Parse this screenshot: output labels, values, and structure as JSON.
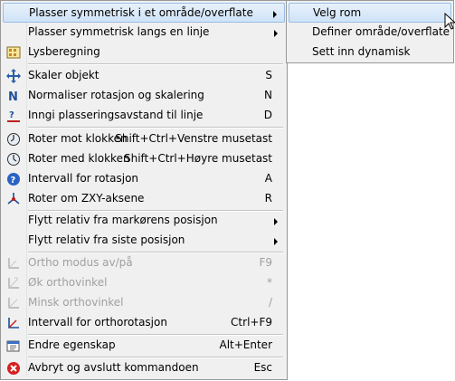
{
  "menu": {
    "items": [
      {
        "label": "Plasser symmetrisk i et område/overflate",
        "shortcut": "",
        "submenu": true,
        "icon": "none",
        "highlight": true
      },
      {
        "label": "Plasser symmetrisk langs en linje",
        "shortcut": "",
        "submenu": true,
        "icon": "none"
      },
      {
        "label": "Lysberegning",
        "shortcut": "",
        "icon": "light-calc-icon"
      },
      {
        "label": "Skaler objekt",
        "shortcut": "S",
        "icon": "scale-icon"
      },
      {
        "label": "Normaliser rotasjon og skalering",
        "shortcut": "N",
        "icon": "normalize-icon"
      },
      {
        "label": "Inngi plasseringsavstand til linje",
        "shortcut": "D",
        "icon": "distance-icon"
      },
      {
        "label": "Roter mot klokken",
        "shortcut": "Shift+Ctrl+Venstre musetast",
        "icon": "rotate-ccw-icon"
      },
      {
        "label": "Roter med klokken",
        "shortcut": "Shift+Ctrl+Høyre musetast",
        "icon": "rotate-cw-icon"
      },
      {
        "label": "Intervall for rotasjon",
        "shortcut": "A",
        "icon": "help-icon"
      },
      {
        "label": "Roter om ZXY-aksene",
        "shortcut": "R",
        "icon": "axes-icon"
      },
      {
        "label": "Flytt relativ fra markørens posisjon",
        "shortcut": "",
        "submenu": true,
        "icon": "none"
      },
      {
        "label": "Flytt relativ fra siste posisjon",
        "shortcut": "",
        "submenu": true,
        "icon": "none"
      },
      {
        "label": "Ortho modus av/på",
        "shortcut": "F9",
        "icon": "ortho-icon",
        "disabled": true
      },
      {
        "label": "Øk orthovinkel",
        "shortcut": "*",
        "icon": "ortho-increase-icon",
        "disabled": true
      },
      {
        "label": "Minsk orthovinkel",
        "shortcut": "/",
        "icon": "ortho-decrease-icon",
        "disabled": true
      },
      {
        "label": "Intervall for orthorotasjon",
        "shortcut": "Ctrl+F9",
        "icon": "ortho-interval-icon"
      },
      {
        "label": "Endre egenskap",
        "shortcut": "Alt+Enter",
        "icon": "properties-icon"
      },
      {
        "label": "Avbryt og avslutt kommandoen",
        "shortcut": "Esc",
        "icon": "cancel-icon"
      }
    ]
  },
  "submenu": {
    "items": [
      {
        "label": "Velg rom",
        "highlight": true
      },
      {
        "label": "Definer område/overflate"
      },
      {
        "label": "Sett inn dynamisk"
      }
    ]
  },
  "colors": {
    "menu_bg": "#f0f0f0",
    "highlight_border": "#97bde6",
    "disabled_text": "#a0a0a0",
    "cancel_red": "#d42020"
  }
}
